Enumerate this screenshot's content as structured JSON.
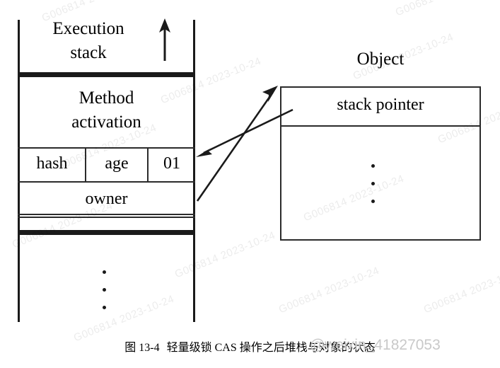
{
  "diagram": {
    "type": "jvm-lightweight-lock-stack-object",
    "stack": {
      "title_line1": "Execution",
      "title_line2": "stack",
      "up_arrow_icon": "arrow-up-icon",
      "frame": {
        "title_line1": "Method",
        "title_line2": "activation",
        "mark_word_cells": [
          {
            "label": "hash"
          },
          {
            "label": "age"
          },
          {
            "label": "01"
          }
        ],
        "owner_label": "owner"
      },
      "continuation_dots": "⋮"
    },
    "object": {
      "title": "Object",
      "rows": [
        {
          "label": "stack pointer"
        }
      ],
      "continuation_dots": "⋮"
    },
    "connectors": [
      {
        "name": "owner-to-object-pointer",
        "from": "owner",
        "to": "object-box-top-left",
        "direction": "up-right"
      },
      {
        "name": "stack-pointer-to-lock-record",
        "from": "stack pointer",
        "to": "mark-word-01",
        "direction": "down-left"
      }
    ]
  },
  "caption": {
    "figure_number": "图 13-4",
    "text": "轻量级锁 CAS 操作之后堆栈与对象的状态"
  },
  "watermarks": {
    "user": "@weixin_41827053",
    "tiled": "G006814 2023-10-24"
  },
  "colors": {
    "ink": "#1a1a1a",
    "rule": "#2b2b2b",
    "background": "#ffffff",
    "watermark": "#c9c9c9"
  }
}
